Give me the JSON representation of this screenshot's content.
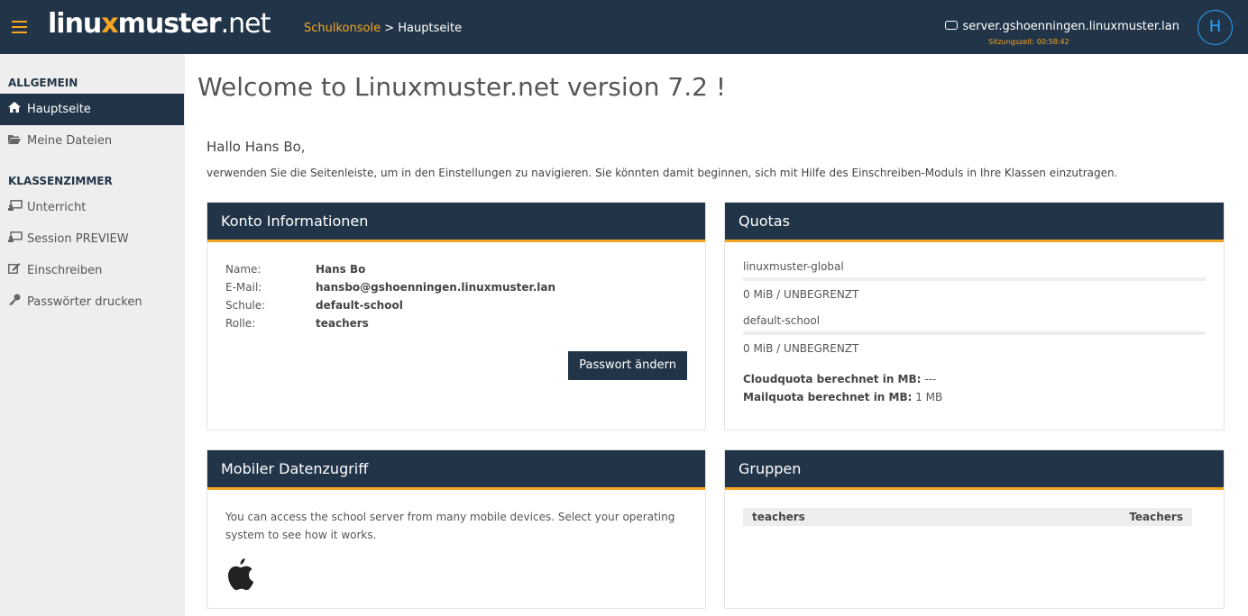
{
  "header": {
    "logo_left": "linu",
    "logo_x": "x",
    "logo_mid": "muster",
    "logo_right": ".net",
    "breadcrumb_link": "Schulkonsole",
    "breadcrumb_sep": " > ",
    "breadcrumb_current": "Hauptseite",
    "server": "server.gshoenningen.linuxmuster.lan",
    "session": "Sitzungszeit: 00:58:42",
    "avatar_letter": "H"
  },
  "sidebar": {
    "heading1": "ALLGEMEIN",
    "items1": [
      {
        "label": "Hauptseite",
        "icon": "home-icon"
      },
      {
        "label": "Meine Dateien",
        "icon": "folder-icon"
      }
    ],
    "heading2": "KLASSENZIMMER",
    "items2": [
      {
        "label": "Unterricht",
        "icon": "classroom-icon"
      },
      {
        "label": "Session PREVIEW",
        "icon": "classroom-icon"
      },
      {
        "label": "Einschreiben",
        "icon": "edit-icon"
      },
      {
        "label": "Passwörter drucken",
        "icon": "key-icon"
      }
    ]
  },
  "main": {
    "title": "Welcome to Linuxmuster.net version 7.2 !",
    "hello": "Hallo Hans Bo,",
    "intro": "verwenden Sie die Seitenleiste, um in den Einstellungen zu navigieren. Sie könnten damit beginnen, sich mit Hilfe des Einschreiben-Moduls in Ihre Klassen einzutragen."
  },
  "account": {
    "title": "Konto Informationen",
    "rows": [
      {
        "key": "Name:",
        "value": "Hans Bo"
      },
      {
        "key": "E-Mail:",
        "value": "hansbo@gshoenningen.linuxmuster.lan"
      },
      {
        "key": "Schule:",
        "value": "default-school"
      },
      {
        "key": "Rolle:",
        "value": "teachers"
      }
    ],
    "button": "Passwort ändern"
  },
  "quotas": {
    "title": "Quotas",
    "items": [
      {
        "label": "linuxmuster-global",
        "value": "0 MiB / UNBEGRENZT",
        "used_fraction": 0
      },
      {
        "label": "default-school",
        "value": "0 MiB / UNBEGRENZT",
        "used_fraction": 0
      }
    ],
    "cloud_label": "Cloudquota berechnet in MB:",
    "cloud_value": " ---",
    "mail_label": "Mailquota berechnet in MB:",
    "mail_value": " 1 MB"
  },
  "mobile": {
    "title": "Mobiler Datenzugriff",
    "text": "You can access the school server from many mobile devices. Select your operating system to see how it works."
  },
  "groups": {
    "title": "Gruppen",
    "rows": [
      {
        "name": "teachers",
        "display": "Teachers"
      }
    ]
  },
  "colors": {
    "primary": "#223548",
    "accent": "#f5a623",
    "avatar": "#29a3ff"
  }
}
